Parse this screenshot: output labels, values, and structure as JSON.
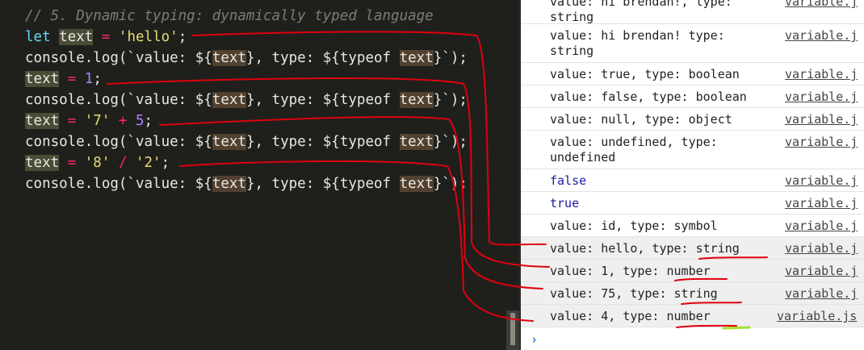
{
  "editor": {
    "comment": "// 5. Dynamic typing: dynamically typed language",
    "kw_let": "let",
    "var": "text",
    "eq": " = ",
    "str_hello": "'hello'",
    "semi": ";",
    "log_prefix": "console.log(`value: ${",
    "log_mid": "}, type: ${typeof ",
    "log_suffix": "}`);",
    "num_1": "1",
    "str_7": "'7'",
    "plus": " + ",
    "num_5": "5",
    "str_8": "'8'",
    "slash": " / ",
    "str_2": "'2'"
  },
  "console": {
    "rows": [
      {
        "text": "value: hi brendan!, type:\nstring",
        "source": "variable.j"
      },
      {
        "text": "value: hi brendan! type:\nstring",
        "source": "variable.j"
      },
      {
        "text": "value: true, type: boolean",
        "source": "variable.j"
      },
      {
        "text": "value: false, type: boolean",
        "source": "variable.j"
      },
      {
        "text": "value: null, type: object",
        "source": "variable.j"
      },
      {
        "text": "value: undefined, type:\nundefined",
        "source": "variable.j"
      },
      {
        "text": "false",
        "source": "variable.j"
      },
      {
        "text": "true",
        "source": "variable.j"
      },
      {
        "text": "value: id, type: symbol",
        "source": "variable.j"
      },
      {
        "text": "value: hello, type: string",
        "source": "variable.j"
      },
      {
        "text": "value: 1, type: number",
        "source": "variable.j"
      },
      {
        "text": "value: 75, type: string",
        "source": "variable.j"
      },
      {
        "text": "value: 4, type: number",
        "source": "variable.js"
      }
    ],
    "prompt": "›"
  },
  "colors": {
    "annotation": "#e0000f",
    "highlight": "#a6e22e"
  }
}
